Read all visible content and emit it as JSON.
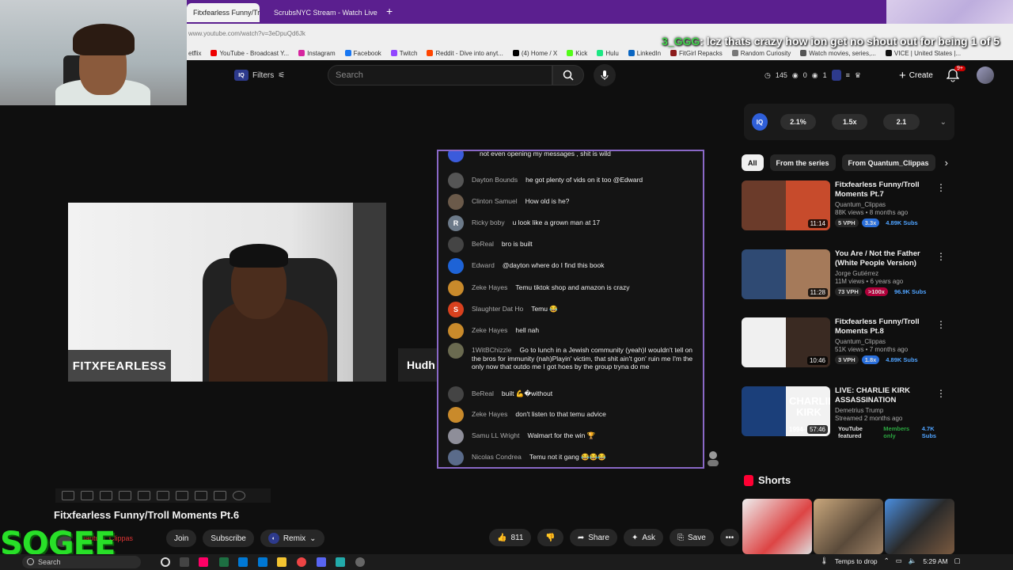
{
  "browser": {
    "tabs": [
      {
        "label": "Fitxfearless Funny/Tro",
        "active": true
      },
      {
        "label": "ScrubsNYC Stream - Watch Live",
        "active": false
      }
    ],
    "url": "www.youtube.com/watch?v=3eDpuQd6Jk",
    "bookmarks": [
      "etflix",
      "YouTube - Broadcast Y...",
      "Instagram",
      "Facebook",
      "Twitch",
      "Reddit - Dive into anyt...",
      "(4) Home / X",
      "Kick",
      "Hulu",
      "LinkedIn",
      "FitGirl Repacks",
      "Random Curiosity",
      "Watch movies, series,...",
      "VICE | United States |..."
    ],
    "overlay_user": "3_GGG",
    "overlay_message": ": lcz thats crazy how ion get no shout out for being 1 of 5"
  },
  "masthead": {
    "filters_label": "Filters",
    "search_placeholder": "Search",
    "stats": [
      "145",
      "0",
      "1"
    ],
    "create_label": "Create",
    "notif_badge": "9+"
  },
  "video": {
    "name_label": "FITXFEARLESS",
    "next_tile_label": "Hudh",
    "title": "Fitxfearless Funny/Troll Moments Pt.6",
    "channel": "Quantum_Clippas",
    "join_label": "Join",
    "subscribe_label": "Subscribe",
    "remix_label": "Remix",
    "likes": "811",
    "share_label": "Share",
    "ask_label": "Ask",
    "save_label": "Save"
  },
  "chat": {
    "messages": [
      {
        "name": "",
        "text": "not even opening my messages , shit is wild",
        "color": "#3b5bdb",
        "initial": ""
      },
      {
        "name": "Dayton Bounds",
        "text": "he got plenty of vids on it too @Edward",
        "color": "#555",
        "initial": ""
      },
      {
        "name": "Clinton Samuel",
        "text": "How old is he?",
        "color": "#6b5a4a",
        "initial": ""
      },
      {
        "name": "Ricky boby",
        "text": "u look like a grown man at 17",
        "color": "#6c7a89",
        "initial": "R"
      },
      {
        "name": "BeReal",
        "text": "bro is built",
        "color": "#444",
        "initial": ""
      },
      {
        "name": "Edward",
        "text": "@dayton where do I find this book",
        "color": "#1e63d6",
        "initial": ""
      },
      {
        "name": "Zeke Hayes",
        "text": "Temu tiktok shop and amazon is crazy",
        "color": "#c98a2b",
        "initial": ""
      },
      {
        "name": "Slaughter Dat Ho",
        "text": "Temu 😂",
        "color": "#d9411e",
        "initial": "S"
      },
      {
        "name": "Zeke Hayes",
        "text": "hell nah",
        "color": "#c98a2b",
        "initial": ""
      },
      {
        "name": "1WitBChizzle",
        "text": "Go to lunch in a Jewish community (yeah)I wouldn't tell on the bros for immunity (nah)Playin' victim, that shit ain't gon' ruin me I'm the only now that outdo me I got hoes by the group tryna do me",
        "color": "#6a6a50",
        "initial": ""
      },
      {
        "name": "BeReal",
        "text": "built 💪�without",
        "color": "#444",
        "initial": ""
      },
      {
        "name": "Zeke Hayes",
        "text": "don't listen to that temu advice",
        "color": "#c98a2b",
        "initial": ""
      },
      {
        "name": "Samu LL Wright",
        "text": "Walmart for the win 🏆",
        "color": "#8e8e99",
        "initial": ""
      },
      {
        "name": "Nicolas Condrea",
        "text": "Temu not it gang 😂😂😂",
        "color": "#5a6b8a",
        "initial": ""
      }
    ]
  },
  "iq": {
    "logo": "IQ",
    "pills": [
      "2.1%",
      "1.5x",
      "2.1"
    ]
  },
  "filters": [
    "All",
    "From the series",
    "From Quantum_Clippas"
  ],
  "recommendations": [
    {
      "title": "Fitxfearless Funny/Troll Moments Pt.7",
      "channel": "Quantum_Clippas",
      "meta": "88K views • 8 months ago",
      "duration": "11:14",
      "tags": [
        "5 VPH",
        "3.3x",
        "4.89K Subs"
      ],
      "colors": [
        "#6b3b2a",
        "#c74b2c"
      ]
    },
    {
      "title": "You Are / Not the Father (White People Version)",
      "channel": "Jorge Gutiérrez",
      "meta": "11M views • 6 years ago",
      "duration": "11:28",
      "tags": [
        "73 VPH",
        ">100x",
        "96.9K Subs"
      ],
      "colors": [
        "#2f4a73",
        "#a57a5a"
      ]
    },
    {
      "title": "Fitxfearless Funny/Troll Moments Pt.8",
      "channel": "Quantum_Clippas",
      "meta": "51K views • 7 months ago",
      "duration": "10:46",
      "tags": [
        "3 VPH",
        "1.8x",
        "4.89K Subs"
      ],
      "colors": [
        "#f0f0f0",
        "#3a2a22"
      ]
    },
    {
      "title": "LIVE: CHARLIE KIRK ASSASSINATION",
      "channel": "Demetrius Trump",
      "meta": "Streamed 2 months ago",
      "duration": "57:46",
      "tags": [
        "YouTube featured",
        "Members only",
        "4.7K Subs"
      ],
      "colors": [
        "#1b3f7a",
        "#f2f2f2"
      ],
      "thumb_text": "CHARLIE KIRK",
      "thumb_years": "1994-"
    }
  ],
  "shorts_label": "Shorts",
  "streamer_logo": "SOGEE",
  "taskbar": {
    "search": "Search",
    "weather": "Temps to drop",
    "time": "5:29 AM"
  }
}
